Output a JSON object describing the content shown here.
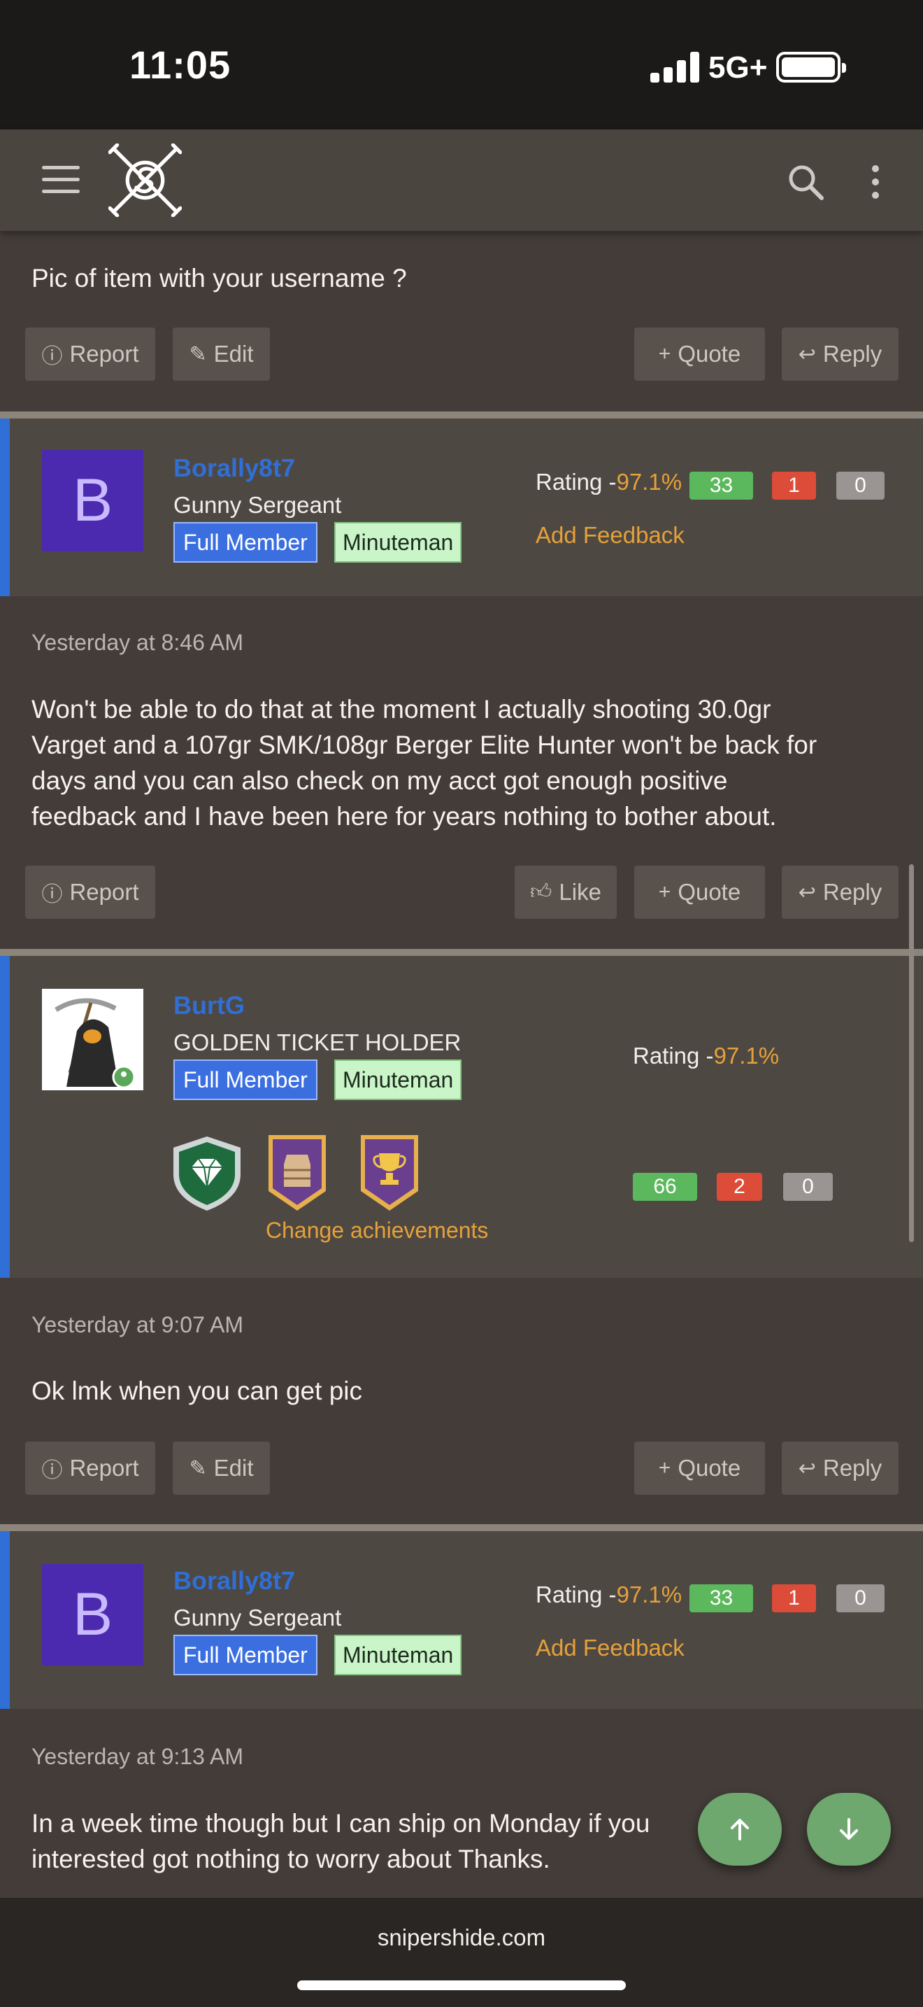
{
  "status_bar": {
    "time": "11:05",
    "network": "5G+"
  },
  "nav": {
    "menu_icon": "hamburger-icon",
    "logo": "snipershide-logo",
    "search_icon": "search-icon",
    "more_icon": "vertical-dots-icon"
  },
  "post0": {
    "text": "Pic of item with your username ?",
    "buttons": {
      "report": "Report",
      "edit": "Edit",
      "quote": "Quote",
      "reply": "Reply"
    }
  },
  "user1": {
    "avatar_letter": "B",
    "username": "Borally8t7",
    "title": "Gunny Sergeant",
    "tag_full": "Full Member",
    "tag_minuteman": "Minuteman",
    "rating_prefix": "Rating -",
    "rating_pct": "97.1%",
    "positive": "33",
    "negative": "1",
    "neutral": "0",
    "feedback_link": "Add Feedback"
  },
  "post1": {
    "date": "Yesterday at 8:46 AM",
    "text_lines": [
      "Won't be able to do that at the moment I actually shooting 30.0gr",
      "Varget and a 107gr SMK/108gr Berger Elite Hunter won't be back for",
      "days and you can also check on my acct got enough positive",
      "feedback and I have been here for years nothing to bother about."
    ],
    "buttons": {
      "report": "Report",
      "like": "Like",
      "quote": "Quote",
      "reply": "Reply"
    }
  },
  "user2": {
    "username": "BurtG",
    "title": "GOLDEN TICKET HOLDER",
    "tag_full": "Full Member",
    "tag_minuteman": "Minuteman",
    "rating_prefix": "Rating -",
    "rating_pct": "97.1%",
    "positive": "66",
    "negative": "2",
    "neutral": "0",
    "achievements_link": "Change achievements",
    "achievement_icons": [
      "diamond-badge-icon",
      "vest-badge-icon",
      "trophy-badge-icon"
    ]
  },
  "post2": {
    "date": "Yesterday at 9:07 AM",
    "text": "Ok lmk when you can get pic",
    "buttons": {
      "report": "Report",
      "edit": "Edit",
      "quote": "Quote",
      "reply": "Reply"
    }
  },
  "user3": {
    "avatar_letter": "B",
    "username": "Borally8t7",
    "title": "Gunny Sergeant",
    "tag_full": "Full Member",
    "tag_minuteman": "Minuteman",
    "rating_prefix": "Rating -",
    "rating_pct": "97.1%",
    "positive": "33",
    "negative": "1",
    "neutral": "0",
    "feedback_link": "Add Feedback"
  },
  "post3": {
    "date": "Yesterday at 9:13 AM",
    "text_lines": [
      "In a week time though but I can ship on Monday if you",
      "interested got nothing to worry about Thanks."
    ]
  },
  "fab": {
    "up_icon": "arrow-up-icon",
    "down_icon": "arrow-down-icon"
  },
  "footer": {
    "domain": "snipershide.com"
  },
  "colors": {
    "accent_blue": "#2f6fd6",
    "accent_orange": "#e5a13a",
    "positive_green": "#5cb85c",
    "negative_red": "#dd4b39"
  }
}
